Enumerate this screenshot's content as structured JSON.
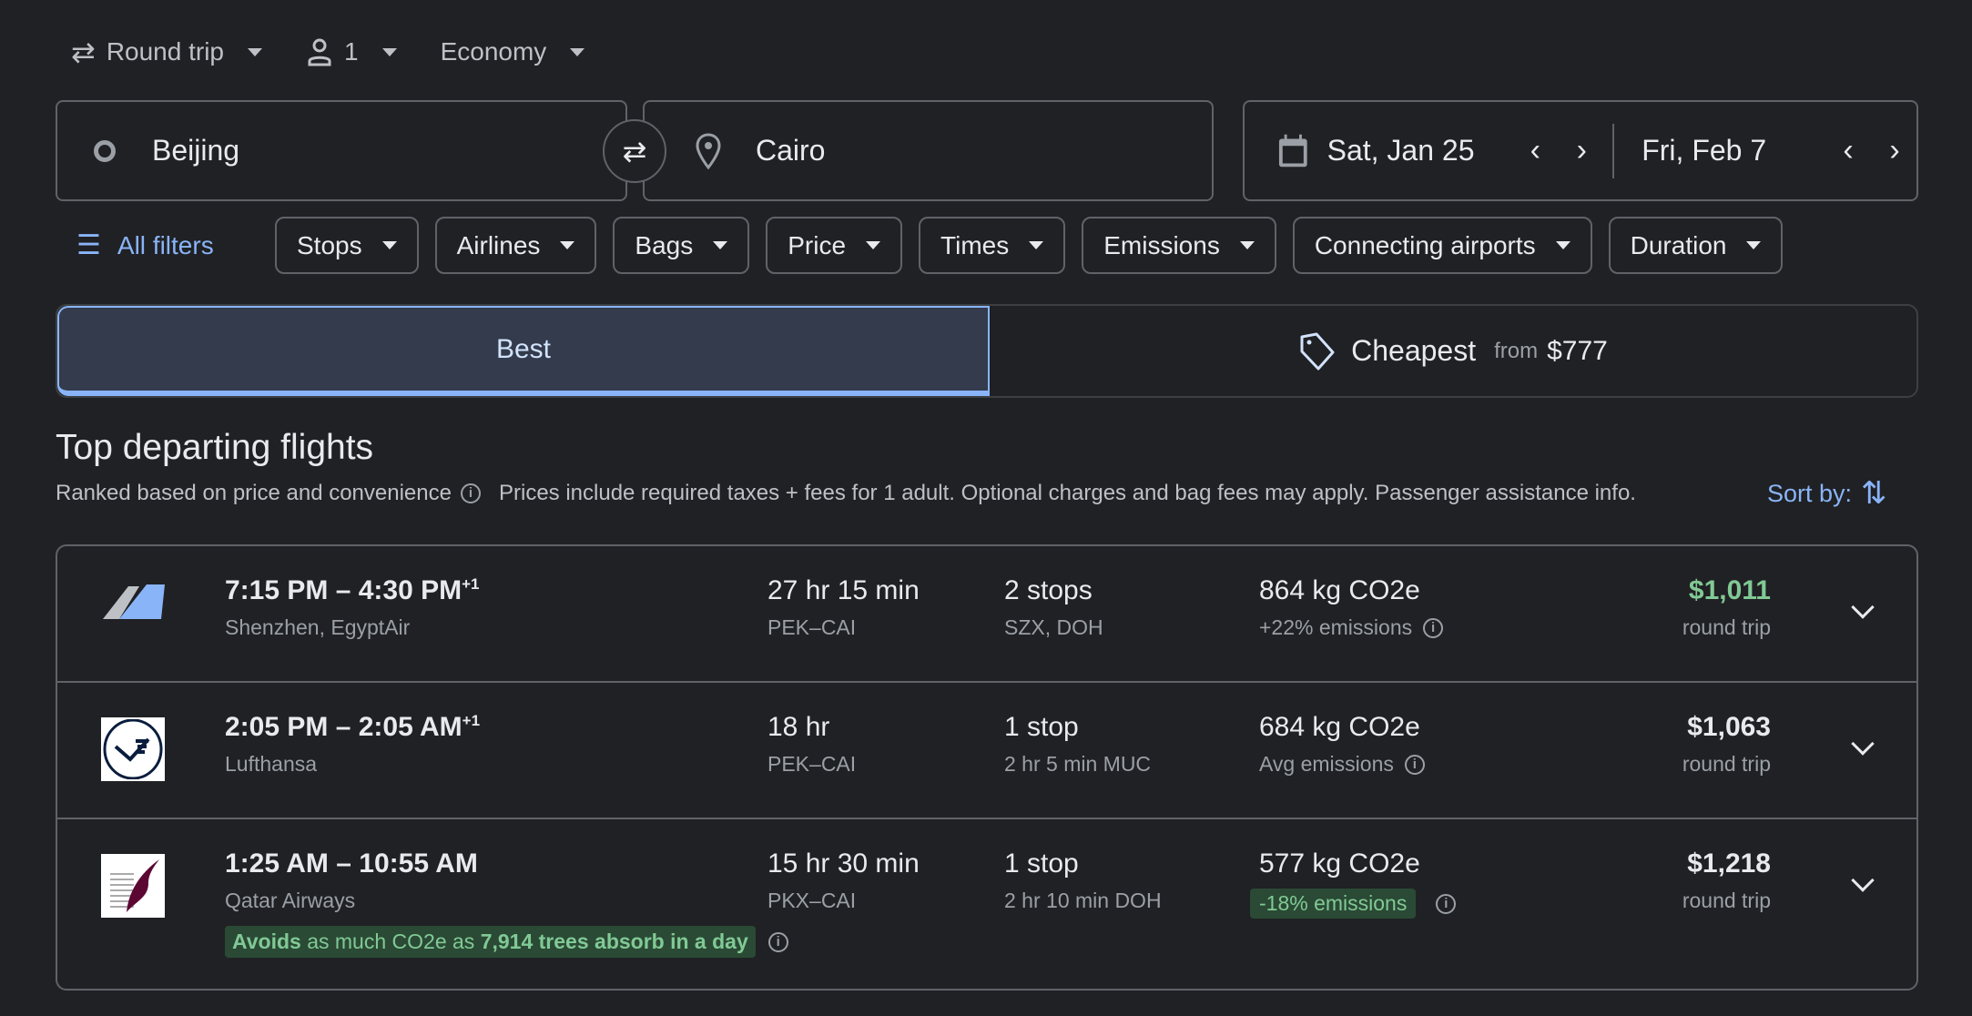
{
  "trip": {
    "type": "Round trip",
    "passengers": "1",
    "cabin": "Economy"
  },
  "search": {
    "origin": "Beijing",
    "destination": "Cairo",
    "depart": "Sat, Jan 25",
    "return": "Fri, Feb 7"
  },
  "filters": {
    "all": "All filters",
    "chips": [
      "Stops",
      "Airlines",
      "Bags",
      "Price",
      "Times",
      "Emissions",
      "Connecting airports",
      "Duration"
    ]
  },
  "tabs": {
    "best": "Best",
    "cheapest": "Cheapest",
    "from": "from",
    "cheapest_price": "$777"
  },
  "section": {
    "title": "Top departing flights",
    "ranked": "Ranked based on price and convenience",
    "prices1": "Prices include required taxes + fees for 1 adult. Optional charges and",
    "bag_fees": "bag fees",
    "prices2": "may apply.",
    "passenger": "Passenger assistance",
    "info": "info.",
    "sort": "Sort by:"
  },
  "colors": {
    "accent": "#8ab4f8",
    "green": "#81c995",
    "green_bg": "#2a4a35"
  },
  "flights": [
    {
      "times": "7:15 PM – 4:30 PM",
      "plus": "+1",
      "airline": "Shenzhen, EgyptAir",
      "duration": "27 hr 15 min",
      "route": "PEK–CAI",
      "stops": "2 stops",
      "stop_detail": "SZX, DOH",
      "co2": "864 kg CO2e",
      "emissions": "+22% emissions",
      "price": "$1,011",
      "price_note": "round trip",
      "logo": "tail-icon"
    },
    {
      "times": "2:05 PM – 2:05 AM",
      "plus": "+1",
      "airline": "Lufthansa",
      "duration": "18 hr",
      "route": "PEK–CAI",
      "stops": "1 stop",
      "stop_detail": "2 hr 5 min MUC",
      "co2": "684 kg CO2e",
      "emissions": "Avg emissions",
      "price": "$1,063",
      "price_note": "round trip",
      "logo": "lufthansa-logo"
    },
    {
      "times": "1:25 AM – 10:55 AM",
      "plus": "",
      "airline": "Qatar Airways",
      "duration": "15 hr 30 min",
      "route": "PKX–CAI",
      "stops": "1 stop",
      "stop_detail": "2 hr 10 min DOH",
      "co2": "577 kg CO2e",
      "emissions": "-18% emissions",
      "price": "$1,218",
      "price_note": "round trip",
      "logo": "qatar-logo",
      "avoid_a": "Avoids",
      "avoid_b": "as much CO2e as",
      "avoid_c": "7,914 trees absorb in a day"
    }
  ]
}
